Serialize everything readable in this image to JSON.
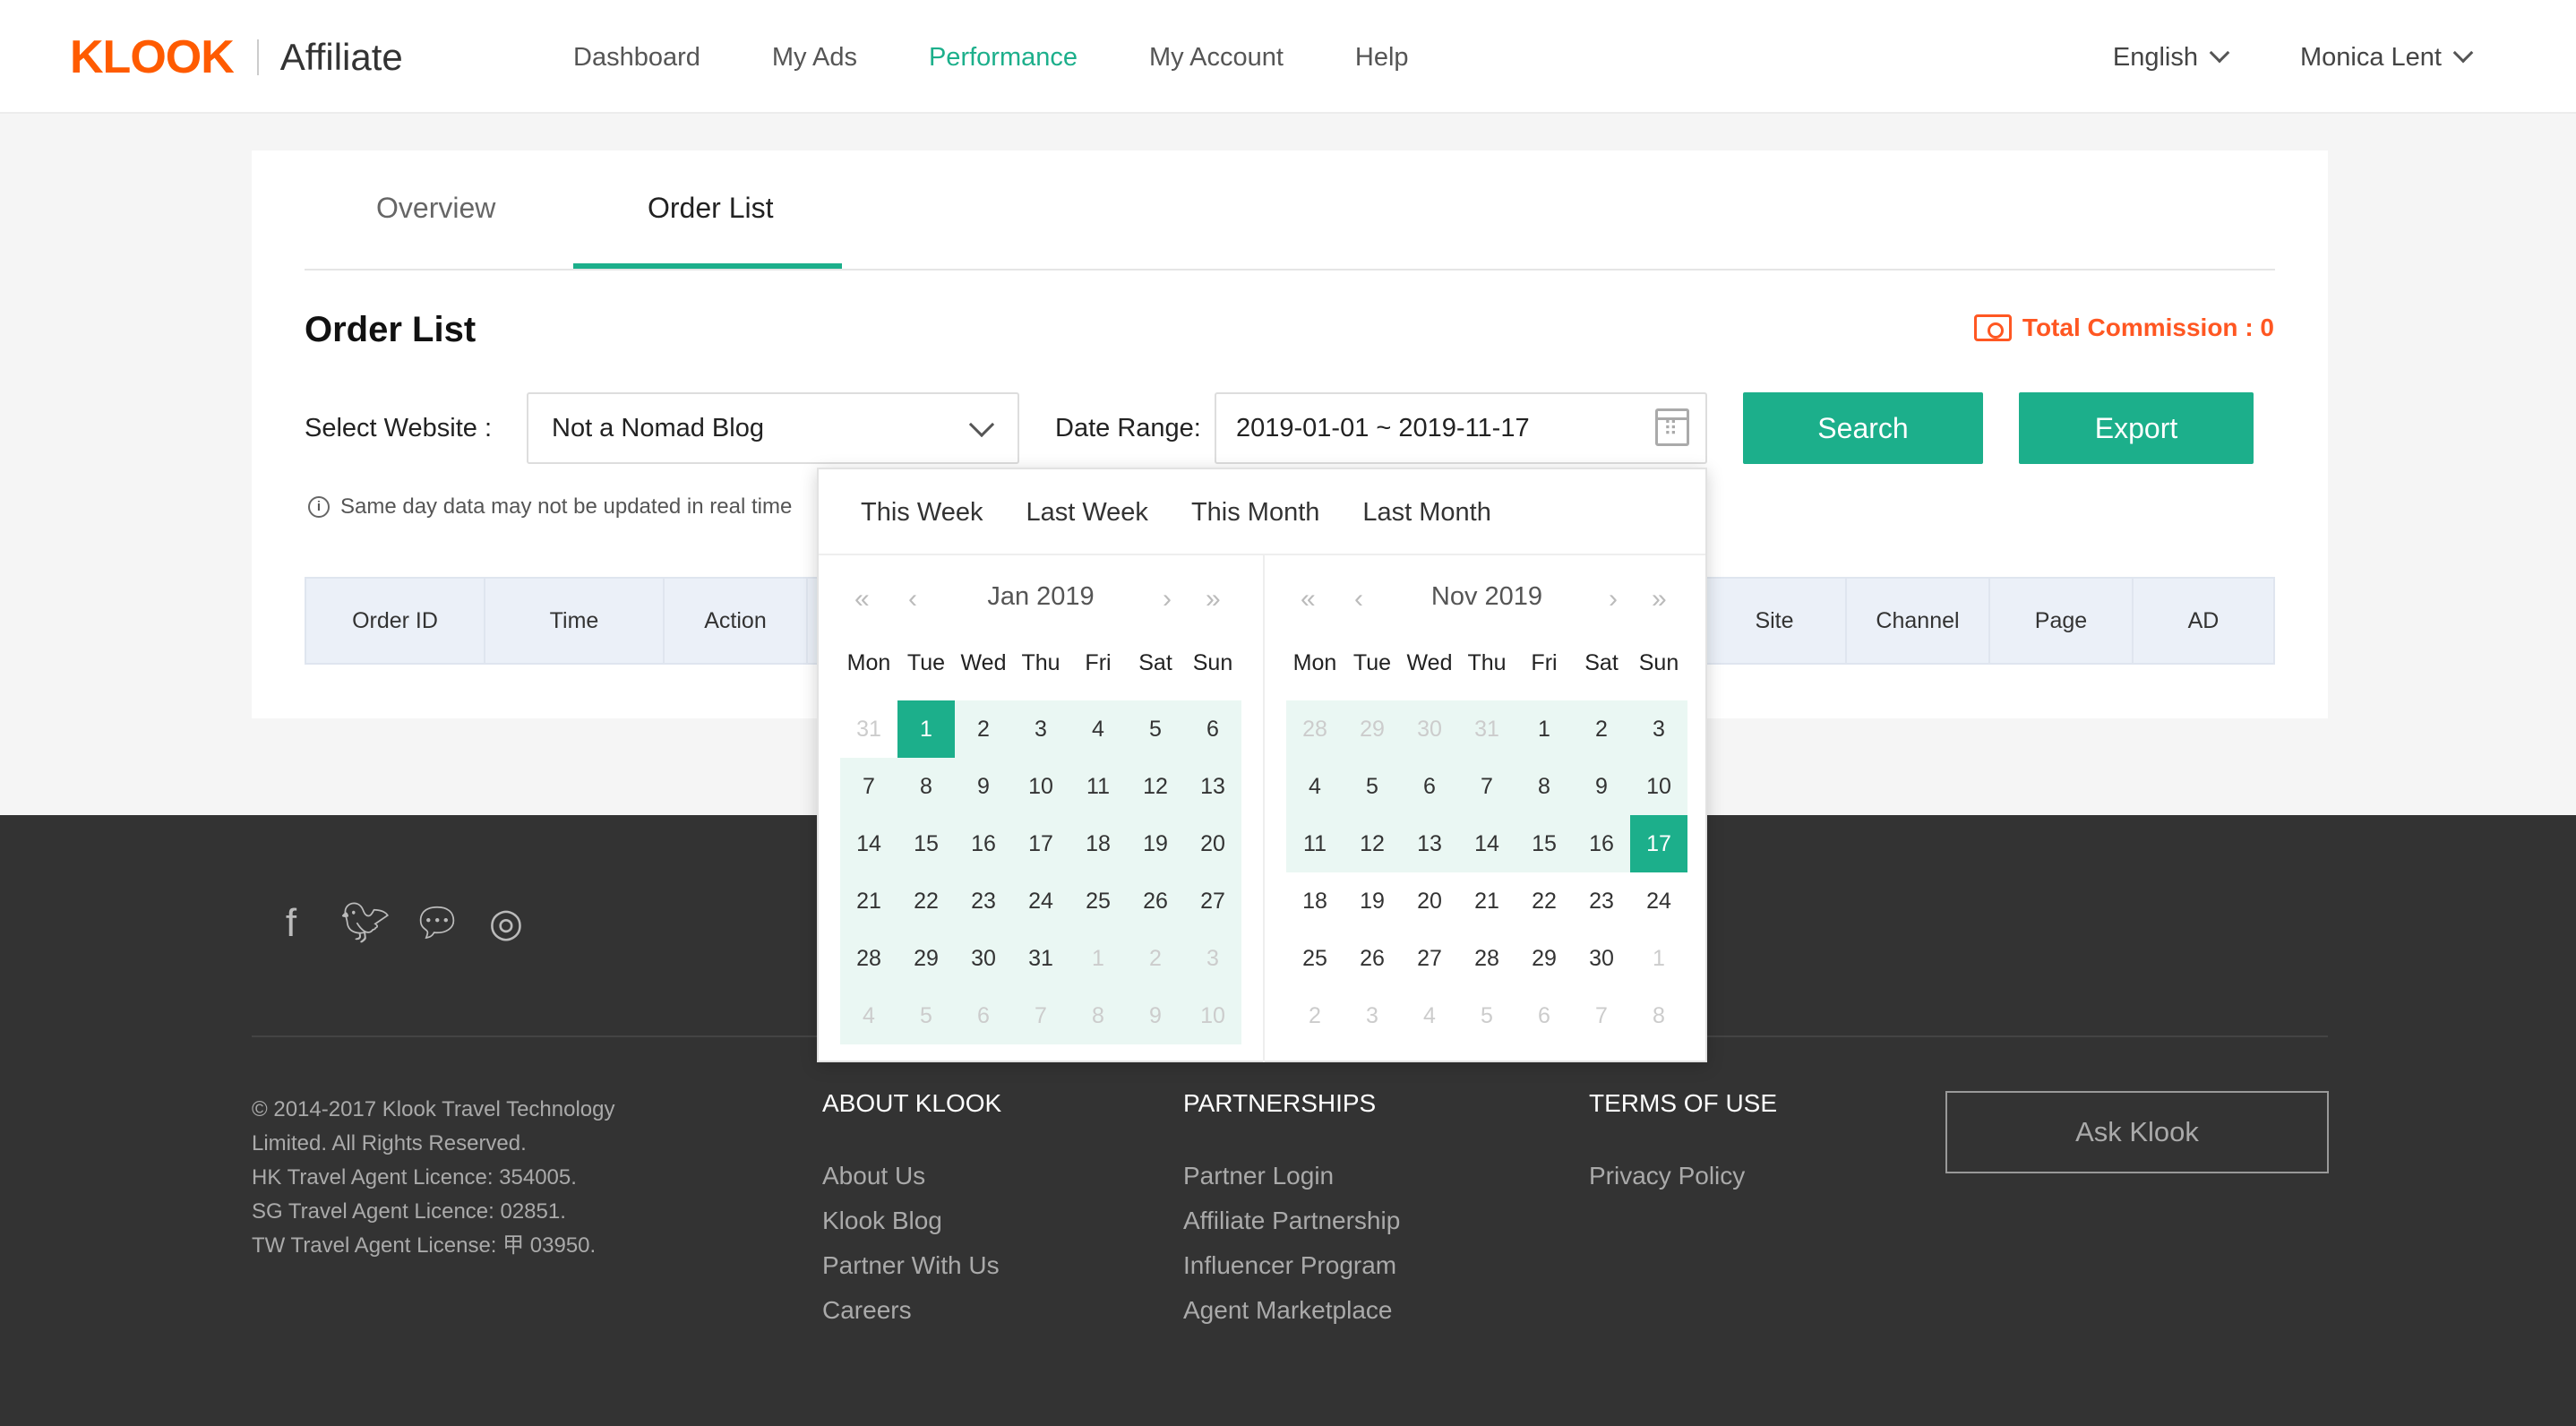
{
  "header": {
    "logo_text": "KLOOK",
    "logo_sub": "Affiliate",
    "nav": [
      "Dashboard",
      "My Ads",
      "Performance",
      "My Account",
      "Help"
    ],
    "active_nav": "Performance",
    "language": "English",
    "user": "Monica Lent"
  },
  "tabs": [
    "Overview",
    "Order List"
  ],
  "active_tab": "Order List",
  "page": {
    "title": "Order List",
    "total_commission": "Total Commission : 0",
    "select_website_label": "Select Website :",
    "select_website_value": "Not a Nomad Blog",
    "date_range_label": "Date Range:",
    "date_range_value": "2019-01-01 ~ 2019-11-17",
    "search_label": "Search",
    "export_label": "Export",
    "note": "Same day data may not be updated in real time"
  },
  "table": {
    "columns": [
      "Order ID",
      "Time",
      "Action",
      "Site",
      "Channel",
      "Page",
      "AD"
    ],
    "hidden_partial": "n"
  },
  "picker": {
    "shortcuts": [
      "This Week",
      "Last Week",
      "This Month",
      "Last Month"
    ],
    "weekdays": [
      "Mon",
      "Tue",
      "Wed",
      "Thu",
      "Fri",
      "Sat",
      "Sun"
    ],
    "nav_prev_year": "«",
    "nav_prev_month": "‹",
    "nav_next_month": "›",
    "nav_next_year": "»",
    "left": {
      "month": "Jan 2019",
      "rows": [
        [
          "31",
          "1",
          "2",
          "3",
          "4",
          "5",
          "6"
        ],
        [
          "7",
          "8",
          "9",
          "10",
          "11",
          "12",
          "13"
        ],
        [
          "14",
          "15",
          "16",
          "17",
          "18",
          "19",
          "20"
        ],
        [
          "21",
          "22",
          "23",
          "24",
          "25",
          "26",
          "27"
        ],
        [
          "28",
          "29",
          "30",
          "31",
          "1",
          "2",
          "3"
        ],
        [
          "4",
          "5",
          "6",
          "7",
          "8",
          "9",
          "10"
        ]
      ],
      "other_month": [
        [
          0,
          0
        ],
        [
          4,
          4
        ],
        [
          4,
          5
        ],
        [
          4,
          6
        ],
        [
          5,
          0
        ],
        [
          5,
          1
        ],
        [
          5,
          2
        ],
        [
          5,
          3
        ],
        [
          5,
          4
        ],
        [
          5,
          5
        ],
        [
          5,
          6
        ]
      ],
      "selected": [
        [
          0,
          1
        ]
      ],
      "range_start": [
        0,
        1
      ],
      "range_all_from": true
    },
    "right": {
      "month": "Nov 2019",
      "rows": [
        [
          "28",
          "29",
          "30",
          "31",
          "1",
          "2",
          "3"
        ],
        [
          "4",
          "5",
          "6",
          "7",
          "8",
          "9",
          "10"
        ],
        [
          "11",
          "12",
          "13",
          "14",
          "15",
          "16",
          "17"
        ],
        [
          "18",
          "19",
          "20",
          "21",
          "22",
          "23",
          "24"
        ],
        [
          "25",
          "26",
          "27",
          "28",
          "29",
          "30",
          "1"
        ],
        [
          "2",
          "3",
          "4",
          "5",
          "6",
          "7",
          "8"
        ]
      ],
      "other_month": [
        [
          0,
          0
        ],
        [
          0,
          1
        ],
        [
          0,
          2
        ],
        [
          0,
          3
        ],
        [
          4,
          6
        ],
        [
          5,
          0
        ],
        [
          5,
          1
        ],
        [
          5,
          2
        ],
        [
          5,
          3
        ],
        [
          5,
          4
        ],
        [
          5,
          5
        ],
        [
          5,
          6
        ]
      ],
      "selected": [
        [
          2,
          6
        ]
      ],
      "range_end": [
        2,
        6
      ]
    }
  },
  "footer": {
    "social": [
      "facebook-icon",
      "twitter-icon",
      "wechat-icon",
      "instagram-icon"
    ],
    "copyright": [
      "© 2014-2017 Klook Travel Technology",
      "Limited. All Rights Reserved.",
      "HK Travel Agent Licence: 354005.",
      "SG Travel Agent Licence: 02851.",
      "TW Travel Agent License: 甲 03950."
    ],
    "about_title": "ABOUT KLOOK",
    "about_links": [
      "About Us",
      "Klook Blog",
      "Partner With Us",
      "Careers"
    ],
    "partnerships_title": "PARTNERSHIPS",
    "partnerships_links": [
      "Partner Login",
      "Affiliate Partnership",
      "Influencer Program",
      "Agent Marketplace"
    ],
    "terms_title": "TERMS OF USE",
    "terms_links": [
      "Privacy Policy"
    ],
    "ask_label": "Ask Klook"
  },
  "colors": {
    "accent": "#1caf8b",
    "brand": "#ff5b00",
    "commission": "#ff5722",
    "footer_bg": "#333333"
  }
}
